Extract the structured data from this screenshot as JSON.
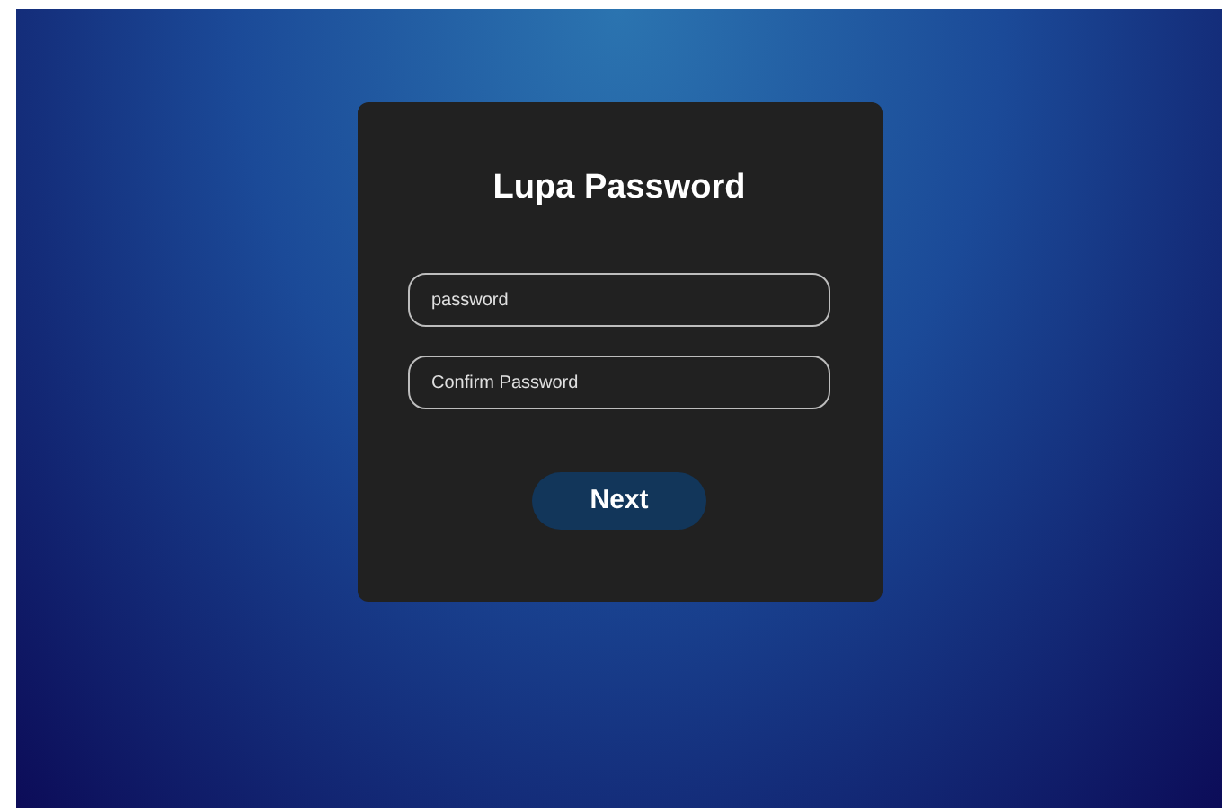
{
  "title": "Lupa Password",
  "fields": [
    {
      "placeholder": "password"
    },
    {
      "placeholder": "Confirm Password"
    }
  ],
  "button": "Next"
}
